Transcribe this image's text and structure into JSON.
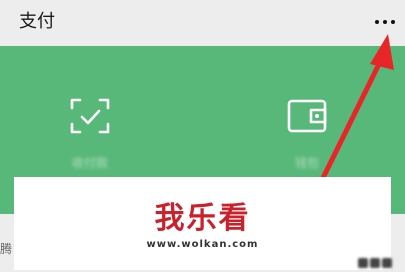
{
  "header": {
    "title": "支付"
  },
  "actions": [
    {
      "name": "scan",
      "icon": "scan-check-icon",
      "label": "收付款"
    },
    {
      "name": "wallet",
      "icon": "wallet-icon",
      "label": "钱包"
    }
  ],
  "watermark": {
    "logo": "我乐看",
    "url": "www.wolkan.com"
  },
  "partial_text": "腾",
  "colors": {
    "accent_green": "#58b879",
    "arrow_red": "#e8262a",
    "header_bg": "#ededed"
  }
}
